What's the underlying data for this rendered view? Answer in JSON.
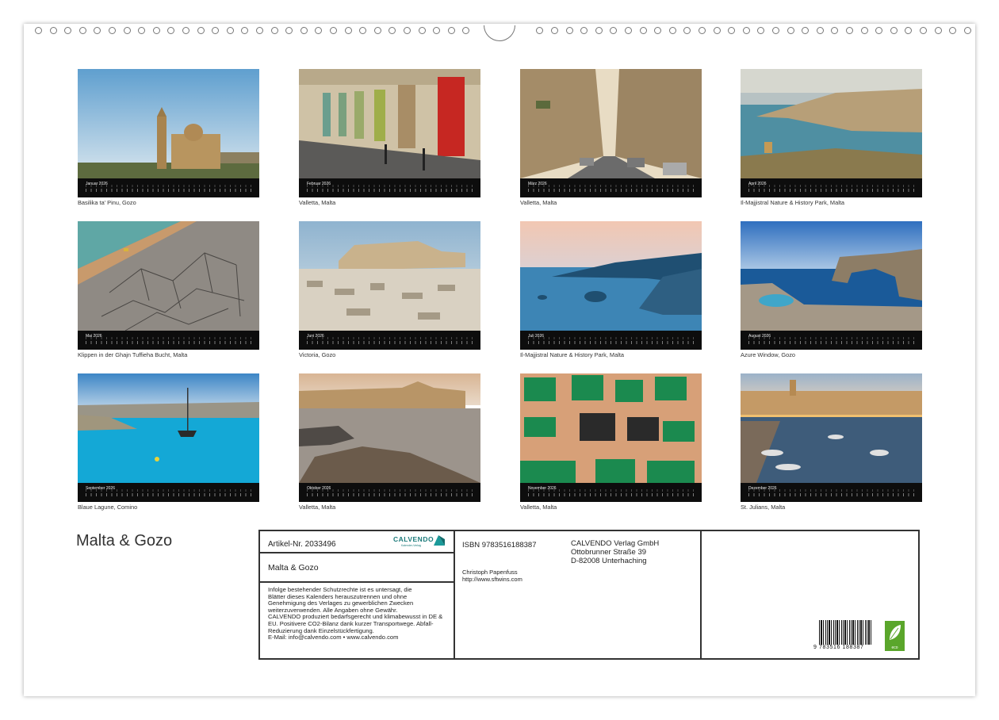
{
  "calendar": {
    "title": "Malta & Gozo",
    "months": [
      {
        "name": "Januar 2026",
        "caption": "Basilika ta' Pinu, Gozo"
      },
      {
        "name": "Februar 2026",
        "caption": "Valletta, Malta"
      },
      {
        "name": "März 2026",
        "caption": "Valletta, Malta"
      },
      {
        "name": "April 2026",
        "caption": "Il-Majjistral Nature & History Park, Malta"
      },
      {
        "name": "Mai 2026",
        "caption": "Klippen in der Ghajn Tuffieha Bucht, Malta"
      },
      {
        "name": "Juni 2026",
        "caption": "Victoria, Gozo"
      },
      {
        "name": "Juli 2026",
        "caption": "Il-Majjistral Nature & History Park, Malta"
      },
      {
        "name": "August 2026",
        "caption": "Azure Window, Gozo"
      },
      {
        "name": "September 2026",
        "caption": "Blaue Lagune, Comino"
      },
      {
        "name": "Oktober 2026",
        "caption": "Valletta, Malta"
      },
      {
        "name": "November 2026",
        "caption": "Valletta, Malta"
      },
      {
        "name": "Dezember 2026",
        "caption": "St. Julians, Malta"
      }
    ]
  },
  "info": {
    "article": "Artikel-Nr. 2033496",
    "logo": "CALVENDO",
    "logo_sub": "Kalender-Verlag",
    "product_title": "Malta & Gozo",
    "legal": "Infolge bestehender Schutzrechte ist es untersagt, die\nBlätter dieses Kalenders herauszutrennen und ohne\nGenehmigung des Verlages zu gewerblichen Zwecken\nweiterzuverwenden. Alle Angaben ohne Gewähr.\nCALVENDO produziert bedarfsgerecht und klimabewusst in DE &\nEU. Positivere CO2-Bilanz dank kurzer Transportwege. Abfall-\nReduzierung dank Einzelstückfertigung.\nE-Mail: info@calvendo.com • www.calvendo.com",
    "isbn": "ISBN 9783516188387",
    "publisher": [
      "CALVENDO Verlag GmbH",
      "Ottobrunner Straße 39",
      "D-82008 Unterhaching"
    ],
    "author": "Christoph Papenfuss",
    "author_url": "http://www.sftwins.com",
    "barcode_number": "9 783516 188387",
    "eco_label": "eco"
  }
}
